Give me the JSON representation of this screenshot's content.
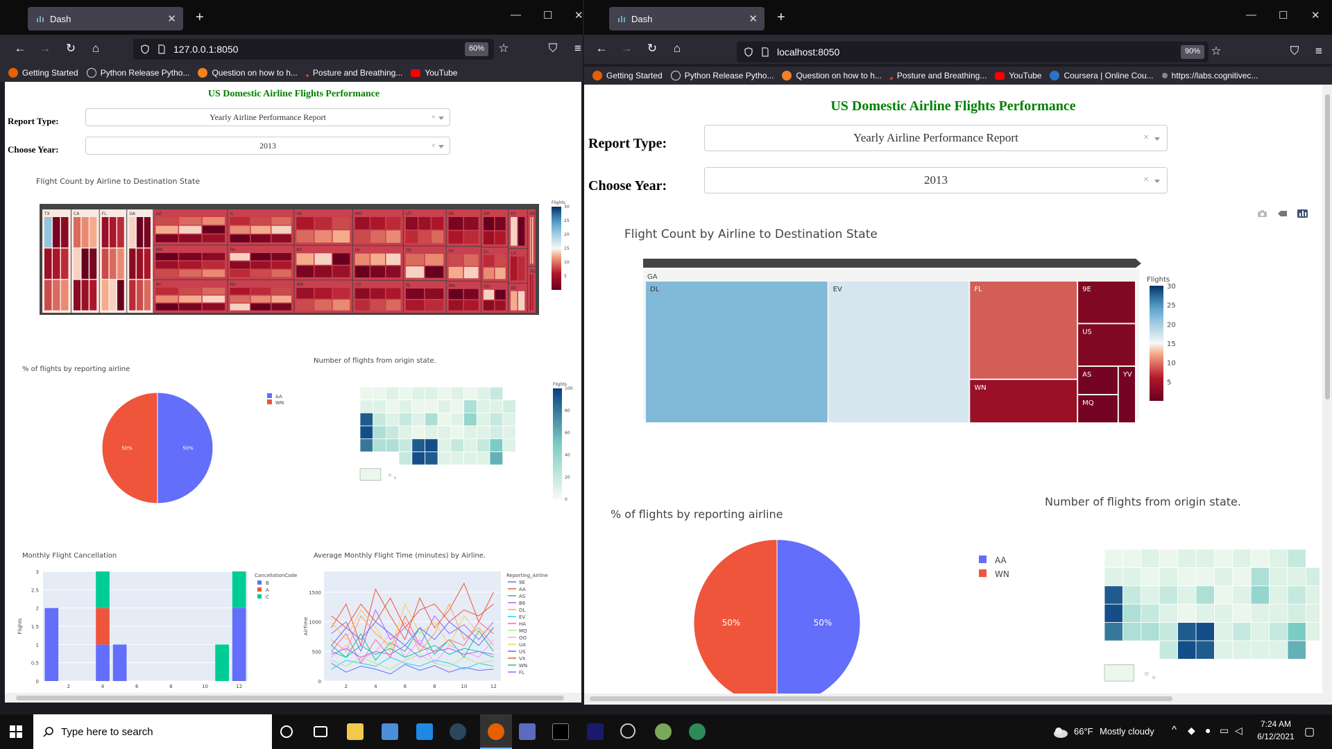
{
  "left_window": {
    "tab_title": "Dash",
    "url": "127.0.0.1:8050",
    "zoom": "60%",
    "bookmarks": [
      "Getting Started",
      "Python Release Pytho...",
      "Question on how to h...",
      "Posture and Breathing...",
      "YouTube"
    ]
  },
  "right_window": {
    "tab_title": "Dash",
    "url": "localhost:8050",
    "zoom": "90%",
    "bookmarks": [
      "Getting Started",
      "Python Release Pytho...",
      "Question on how to h...",
      "Posture and Breathing...",
      "YouTube",
      "Coursera | Online Cou...",
      "https://labs.cognitivec..."
    ]
  },
  "dashboard": {
    "title": "US Domestic Airline Flights Performance",
    "report_type_label": "Report Type:",
    "report_type_value": "Yearly Airline Performance Report",
    "year_label": "Choose Year:",
    "year_value": "2013",
    "clear_symbol": "×"
  },
  "chart_data": [
    {
      "type": "treemap",
      "title": "Flight Count by Airline to Destination State",
      "colorbar_title": "Flights",
      "colorbar_ticks": [
        5,
        10,
        15,
        20,
        25,
        30
      ],
      "zoomed_state": "GA",
      "states": [
        "TX",
        "CA",
        "FL",
        "GA",
        "AZ",
        "MN",
        "NC",
        "IL",
        "PA",
        "NV",
        "VA",
        "NY",
        "WA",
        "MO",
        "HI",
        "CO",
        "UT",
        "TN",
        "NJ",
        "WI",
        "MI",
        "MA",
        "OR",
        "SC",
        "OH",
        "KY",
        "LA",
        "AK",
        "MD",
        "ND"
      ],
      "ga_cells": [
        {
          "label": "DL",
          "flights": 22
        },
        {
          "label": "EV",
          "flights": 17
        },
        {
          "label": "FL",
          "flights": 9
        },
        {
          "label": "WN",
          "flights": 4
        },
        {
          "label": "9E",
          "flights": 2
        },
        {
          "label": "US",
          "flights": 2
        },
        {
          "label": "AS",
          "flights": 1
        },
        {
          "label": "YV",
          "flights": 1
        },
        {
          "label": "MQ",
          "flights": 1
        }
      ]
    },
    {
      "type": "pie",
      "title": "% of flights by reporting airline",
      "labels": [
        "AA",
        "WN"
      ],
      "values": [
        50,
        50
      ],
      "text": [
        "50%",
        "50%"
      ]
    },
    {
      "type": "choropleth",
      "title": "Number of flights from origin state.",
      "colorbar_title": "Flights",
      "colorbar_ticks": [
        0,
        20,
        40,
        60,
        80,
        100
      ]
    },
    {
      "type": "bar",
      "title": "Monthly Flight Cancellation",
      "ylabel": "Flights",
      "legend_title": "CancellationCode",
      "x_ticks": [
        2,
        4,
        6,
        8,
        10,
        12
      ],
      "y_ticks": [
        0,
        0.5,
        1,
        1.5,
        2,
        2.5,
        3
      ],
      "ylim": [
        0,
        3
      ],
      "series": [
        {
          "name": "B",
          "color": "#636efa",
          "x": [
            1,
            4,
            5,
            12
          ],
          "values": [
            2,
            1,
            1,
            2
          ]
        },
        {
          "name": "A",
          "color": "#ef553b",
          "x": [
            4
          ],
          "values": [
            1
          ]
        },
        {
          "name": "C",
          "color": "#00cc96",
          "x": [
            4,
            11,
            12
          ],
          "values": [
            1,
            1,
            1
          ]
        }
      ]
    },
    {
      "type": "line",
      "title": "Average Monthly Flight Time (minutes) by Airline.",
      "ylabel": "AirTime",
      "legend_title": "Reporting_Airline",
      "x_ticks": [
        2,
        4,
        6,
        8,
        10,
        12
      ],
      "y_ticks": [
        0,
        500,
        1000,
        1500
      ],
      "x": [
        1,
        2,
        3,
        4,
        5,
        6,
        7,
        8,
        9,
        10,
        11,
        12
      ],
      "series": [
        {
          "name": "9E",
          "color": "#636efa",
          "values": [
            300,
            150,
            250,
            200,
            120,
            280,
            180,
            260,
            150,
            230,
            180,
            200
          ]
        },
        {
          "name": "AA",
          "color": "#ef553b",
          "values": [
            900,
            1300,
            600,
            1550,
            1100,
            700,
            1400,
            900,
            1200,
            1650,
            1000,
            1500
          ]
        },
        {
          "name": "AS",
          "color": "#00cc96",
          "values": [
            600,
            400,
            800,
            350,
            650,
            500,
            900,
            450,
            700,
            400,
            850,
            500
          ]
        },
        {
          "name": "B6",
          "color": "#ab63fa",
          "values": [
            800,
            1000,
            500,
            1200,
            700,
            900,
            600,
            1100,
            800,
            950,
            700,
            1000
          ]
        },
        {
          "name": "DL",
          "color": "#ffa15a",
          "values": [
            700,
            500,
            1100,
            800,
            600,
            1000,
            500,
            800,
            1300,
            700,
            900,
            600
          ]
        },
        {
          "name": "EV",
          "color": "#19d3f3",
          "values": [
            200,
            350,
            300,
            250,
            400,
            300,
            250,
            350,
            300,
            200,
            300,
            250
          ]
        },
        {
          "name": "HA",
          "color": "#ff6692",
          "values": [
            500,
            800,
            300,
            700,
            400,
            1100,
            600,
            500,
            700,
            600,
            1000,
            800
          ]
        },
        {
          "name": "MQ",
          "color": "#b6e880",
          "values": [
            350,
            250,
            400,
            300,
            200,
            350,
            450,
            300,
            250,
            400,
            300,
            350
          ]
        },
        {
          "name": "OO",
          "color": "#ff97ff",
          "values": [
            400,
            600,
            350,
            500,
            800,
            400,
            700,
            300,
            600,
            500,
            400,
            700
          ]
        },
        {
          "name": "UA",
          "color": "#fecb52",
          "values": [
            1000,
            700,
            1200,
            900,
            500,
            1300,
            800,
            1000,
            600,
            1100,
            800,
            900
          ]
        },
        {
          "name": "US",
          "color": "#636efa",
          "values": [
            600,
            900,
            700,
            1000,
            800,
            600,
            900,
            700,
            1000,
            800,
            600,
            900
          ]
        },
        {
          "name": "VX",
          "color": "#ef553b",
          "values": [
            1100,
            900,
            1300,
            1000,
            1400,
            900,
            1200,
            1300,
            1000,
            1200,
            1100,
            1300
          ]
        },
        {
          "name": "WN",
          "color": "#00cc96",
          "values": [
            500,
            400,
            600,
            450,
            550,
            400,
            500,
            600,
            450,
            550,
            500,
            400
          ]
        },
        {
          "name": "FL",
          "color": "#ab63fa",
          "values": [
            450,
            550,
            400,
            500,
            450,
            600,
            400,
            500,
            550,
            450,
            500,
            450
          ]
        }
      ]
    }
  ],
  "taskbar": {
    "search_placeholder": "Type here to search",
    "weather": "66°F",
    "weather_desc": "Mostly cloudy",
    "time": "7:24 AM",
    "date": "6/12/2021"
  }
}
